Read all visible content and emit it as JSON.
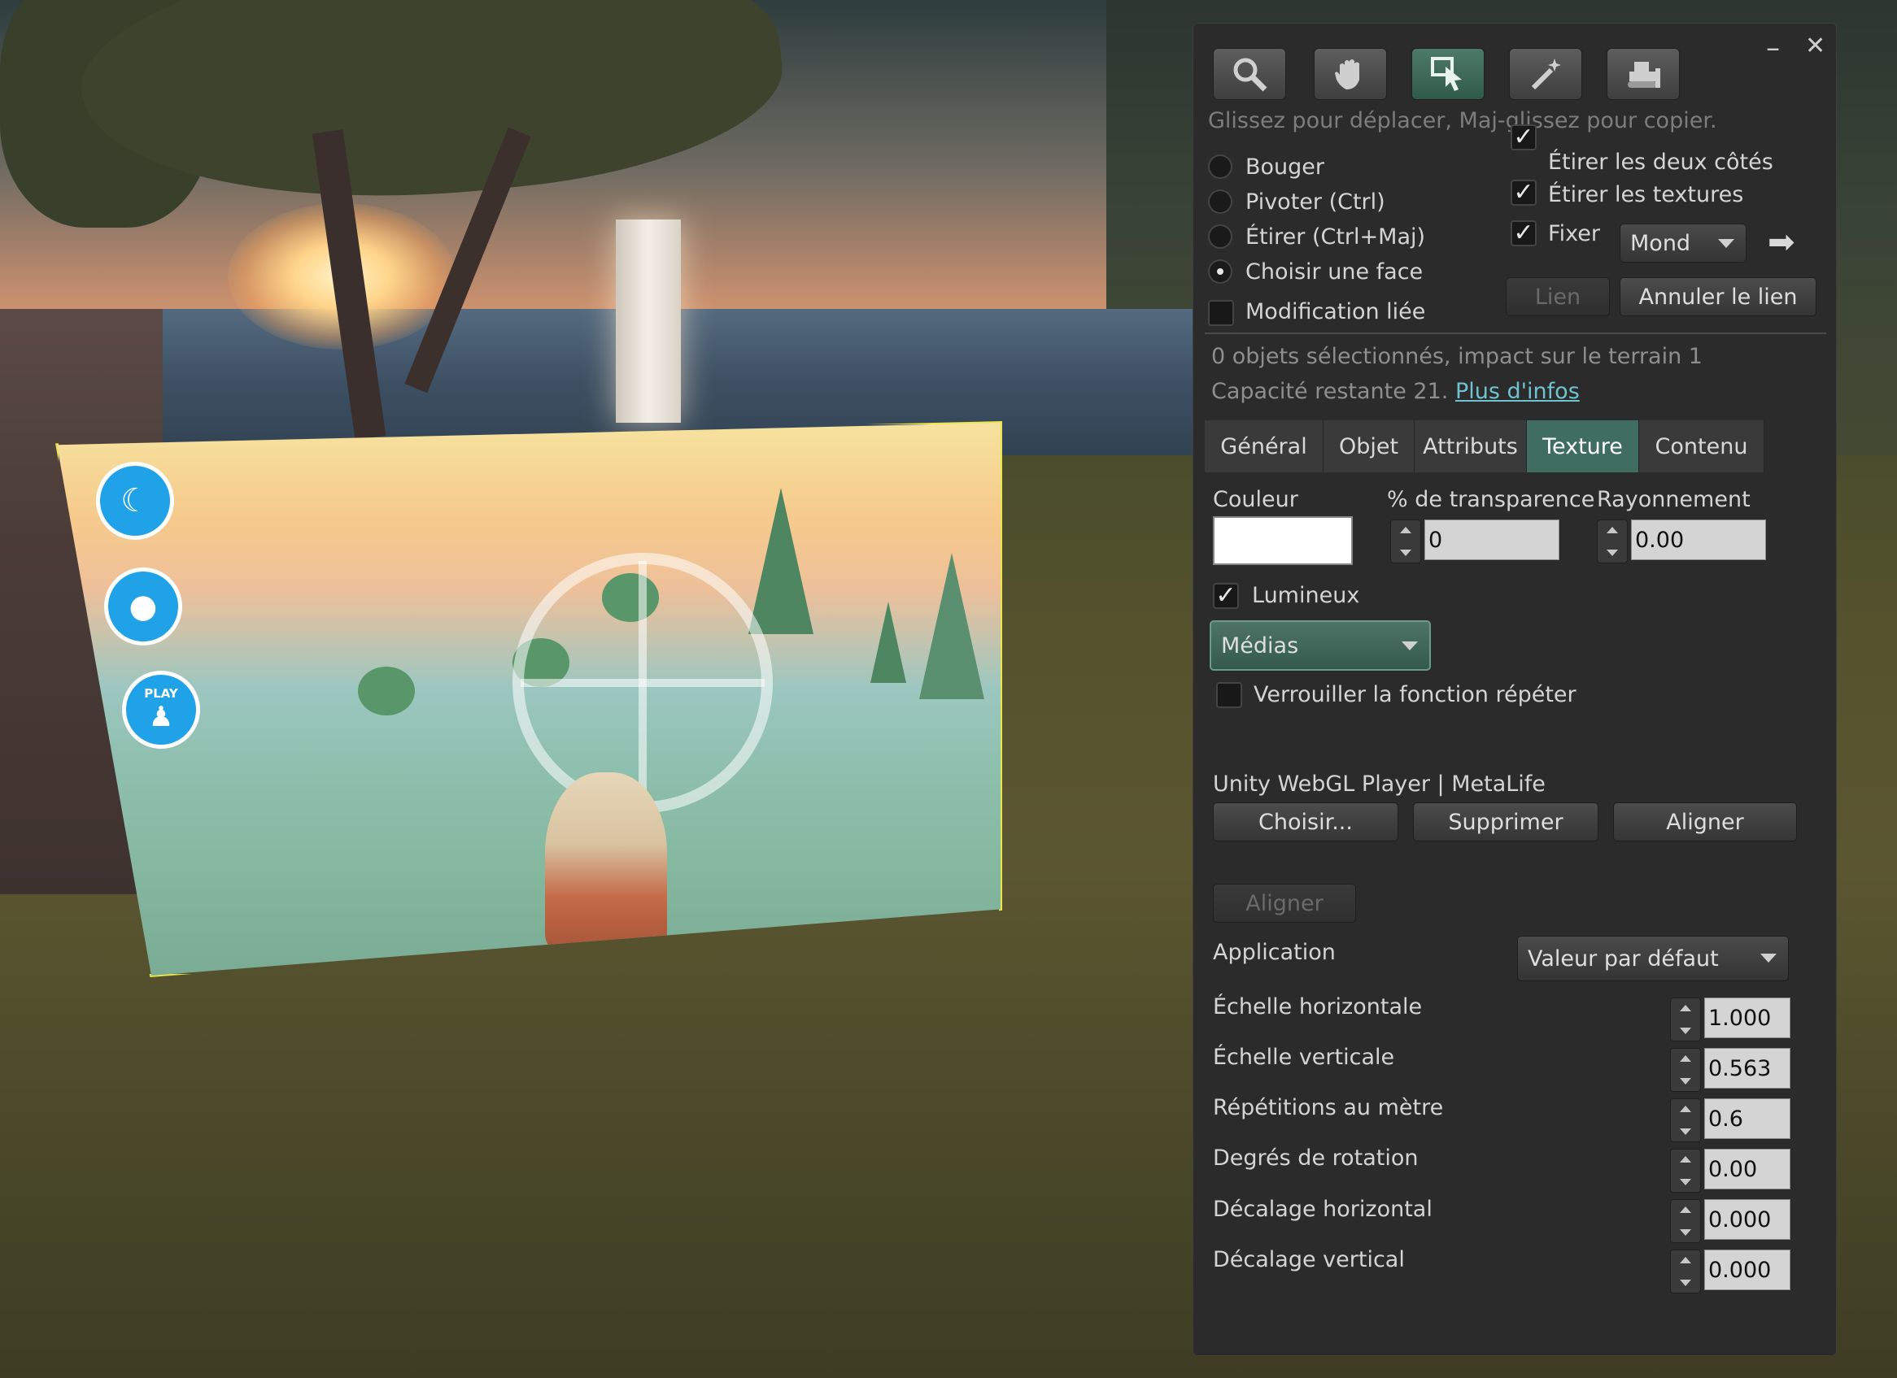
{
  "toolbar": {
    "tools": [
      {
        "name": "zoom",
        "icon": "magnifier-icon"
      },
      {
        "name": "grab",
        "icon": "hand-icon"
      },
      {
        "name": "edit",
        "icon": "pointer-icon",
        "active": true
      },
      {
        "name": "create",
        "icon": "wand-icon"
      },
      {
        "name": "land",
        "icon": "bulldozer-icon"
      }
    ],
    "minimize": "–",
    "close": "✕"
  },
  "hint": "Glissez pour déplacer, Maj-glissez pour copier.",
  "modes": {
    "items": [
      "Bouger",
      "Pivoter (Ctrl)",
      "Étirer (Ctrl+Maj)",
      "Choisir une face"
    ],
    "selected_index": 3,
    "linked_edit": "Modification liée"
  },
  "options": {
    "stretch_both": "Étirer les deux côtés",
    "stretch_textures": "Étirer les textures",
    "snap": "Fixer",
    "snap_ruler": "Mond",
    "arrow": "➡"
  },
  "link_buttons": {
    "link": "Lien",
    "unlink": "Annuler le lien"
  },
  "status": {
    "line1": "0 objets sélectionnés, impact sur le terrain 1",
    "line2": "Capacité restante 21.",
    "more_info": "Plus d'infos"
  },
  "tabs": [
    "Général",
    "Objet",
    "Attributs",
    "Texture",
    "Contenu"
  ],
  "active_tab": "Texture",
  "texture": {
    "color_label": "Couleur",
    "color_value": "#ffffff",
    "transparency_label": "% de transparence",
    "transparency_value": "0",
    "glow_label": "Rayonnement",
    "glow_value": "0.00",
    "fullbright_label": "Lumineux",
    "media_combo": "Médias",
    "lock_repeat": "Verrouiller la fonction répéter",
    "media_name": "Unity WebGL Player | MetaLife",
    "choose": "Choisir...",
    "remove": "Supprimer",
    "align": "Aligner",
    "align_disabled": "Aligner",
    "mapping_label": "Application",
    "mapping_value": "Valeur par défaut",
    "params": [
      {
        "label": "Échelle horizontale",
        "value": "1.000"
      },
      {
        "label": "Échelle verticale",
        "value": "0.563"
      },
      {
        "label": "Répétitions au mètre",
        "value": "0.6"
      },
      {
        "label": "Degrés de rotation",
        "value": "0.00"
      },
      {
        "label": "Décalage horizontal",
        "value": "0.000"
      },
      {
        "label": "Décalage vertical",
        "value": "0.000"
      }
    ]
  },
  "screen_ui": {
    "play_label": "PLAY",
    "icons": [
      "night-mode-icon",
      "profile-icon",
      "play-icon"
    ]
  }
}
